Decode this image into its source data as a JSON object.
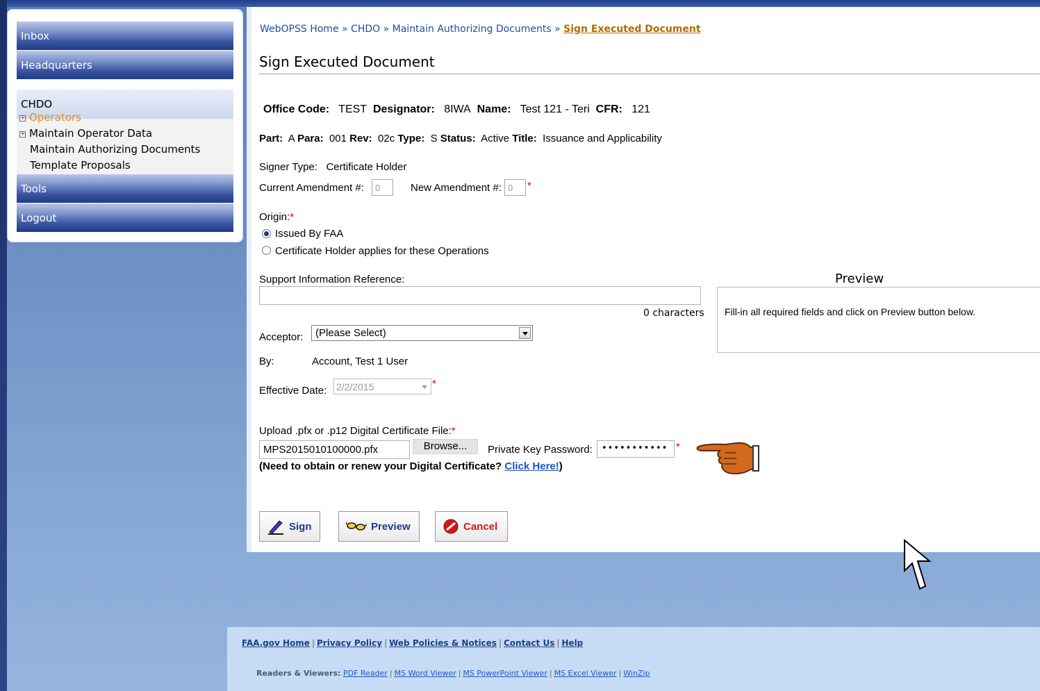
{
  "sidebar": {
    "inbox": "Inbox",
    "headquarters": "Headquarters",
    "chdo": "CHDO",
    "sub_items": [
      "Operators",
      "Maintain Operator Data",
      "Maintain Authorizing Documents",
      "Template Proposals"
    ],
    "tools": "Tools",
    "logout": "Logout"
  },
  "breadcrumb": {
    "home": "WebOPSS Home",
    "sep": "»",
    "chdo": "CHDO",
    "maintain": "Maintain Authorizing Documents",
    "current": "Sign Executed Document"
  },
  "page_title": "Sign Executed Document",
  "info1": {
    "office_code_label": "Office Code:",
    "office_code": "TEST",
    "designator_label": "Designator:",
    "designator": "8IWA",
    "name_label": "Name:",
    "name": "Test 121 - Teri",
    "cfr_label": "CFR:",
    "cfr": "121"
  },
  "info2": {
    "part_label": "Part:",
    "part": "A",
    "para_label": "Para:",
    "para": "001",
    "rev_label": "Rev:",
    "rev": "02c",
    "type_label": "Type:",
    "type": "S",
    "status_label": "Status:",
    "status": "Active",
    "title_label": "Title:",
    "title": "Issuance and Applicability"
  },
  "signer": {
    "label": "Signer Type:",
    "value": "Certificate Holder"
  },
  "amendment": {
    "current_label": "Current Amendment #:",
    "current_value": "0",
    "new_label": "New Amendment #:",
    "new_value": "0"
  },
  "origin": {
    "label": "Origin:",
    "options": [
      "Issued By FAA",
      "Certificate Holder applies for these Operations"
    ],
    "selected": "Issued By FAA"
  },
  "support": {
    "label": "Support Information Reference:",
    "counter": "0 characters"
  },
  "acceptor": {
    "label": "Acceptor:",
    "value": "(Please Select)"
  },
  "by": {
    "label": "By:",
    "value": "Account, Test 1 User"
  },
  "effective_date": {
    "label": "Effective Date:",
    "value": "2/2/2015"
  },
  "preview": {
    "title": "Preview",
    "message": "Fill-in all required fields and click on Preview button below."
  },
  "upload": {
    "label": "Upload .pfx or .p12 Digital Certificate File:",
    "file": "MPS2015010100000.pfx",
    "browse": "Browse...",
    "password_label": "Private Key Password:",
    "password_mask": "•••••••••••",
    "help_prefix": "(Need to obtain or renew your Digital Certificate?",
    "help_link": "Click Here!",
    "help_suffix": ")"
  },
  "actions": {
    "sign": "Sign",
    "preview": "Preview",
    "cancel": "Cancel"
  },
  "footer": {
    "links": [
      "FAA.gov Home",
      "Privacy Policy",
      "Web Policies & Notices",
      "Contact Us",
      "Help"
    ],
    "readers_label": "Readers & Viewers:",
    "readers": [
      "PDF Reader",
      "MS Word Viewer",
      "MS PowerPoint Viewer",
      "MS Excel Viewer",
      "WinZip"
    ],
    "sep": "|"
  },
  "colors": {
    "nav_blue": "#1f3a86",
    "active_orange": "#e88b1a",
    "link_blue": "#1b4f9c",
    "required_red": "#e00000"
  },
  "icons": [
    "expand-icon",
    "pen-icon",
    "glasses-icon",
    "cancel-icon",
    "pointing-hand-icon",
    "mouse-cursor-icon"
  ]
}
